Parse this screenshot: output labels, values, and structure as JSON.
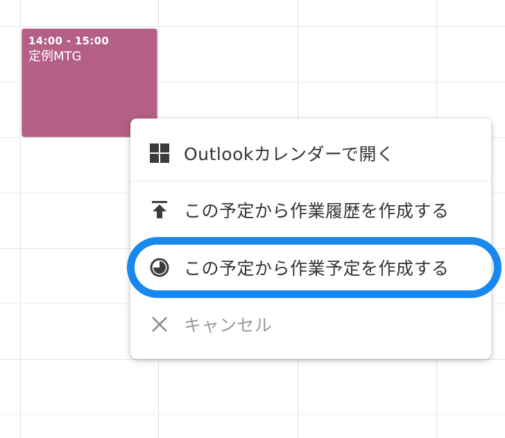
{
  "event": {
    "time": "14:00 - 15:00",
    "title": "定例MTG",
    "color": "#b55f87"
  },
  "context_menu": {
    "items": [
      {
        "label": "Outlookカレンダーで開く",
        "icon": "windows-grid-icon"
      },
      {
        "label": "この予定から作業履歴を作成する",
        "icon": "upload-arrow-icon"
      },
      {
        "label": "この予定から作業予定を作成する",
        "icon": "clock-pie-icon",
        "highlighted": true
      },
      {
        "label": "キャンセル",
        "icon": "close-icon",
        "disabled": true
      }
    ]
  },
  "colors": {
    "highlight": "#1788ed",
    "text": "#333333",
    "disabled_text": "#9a9a9a",
    "grid": "#e2e2e2"
  }
}
